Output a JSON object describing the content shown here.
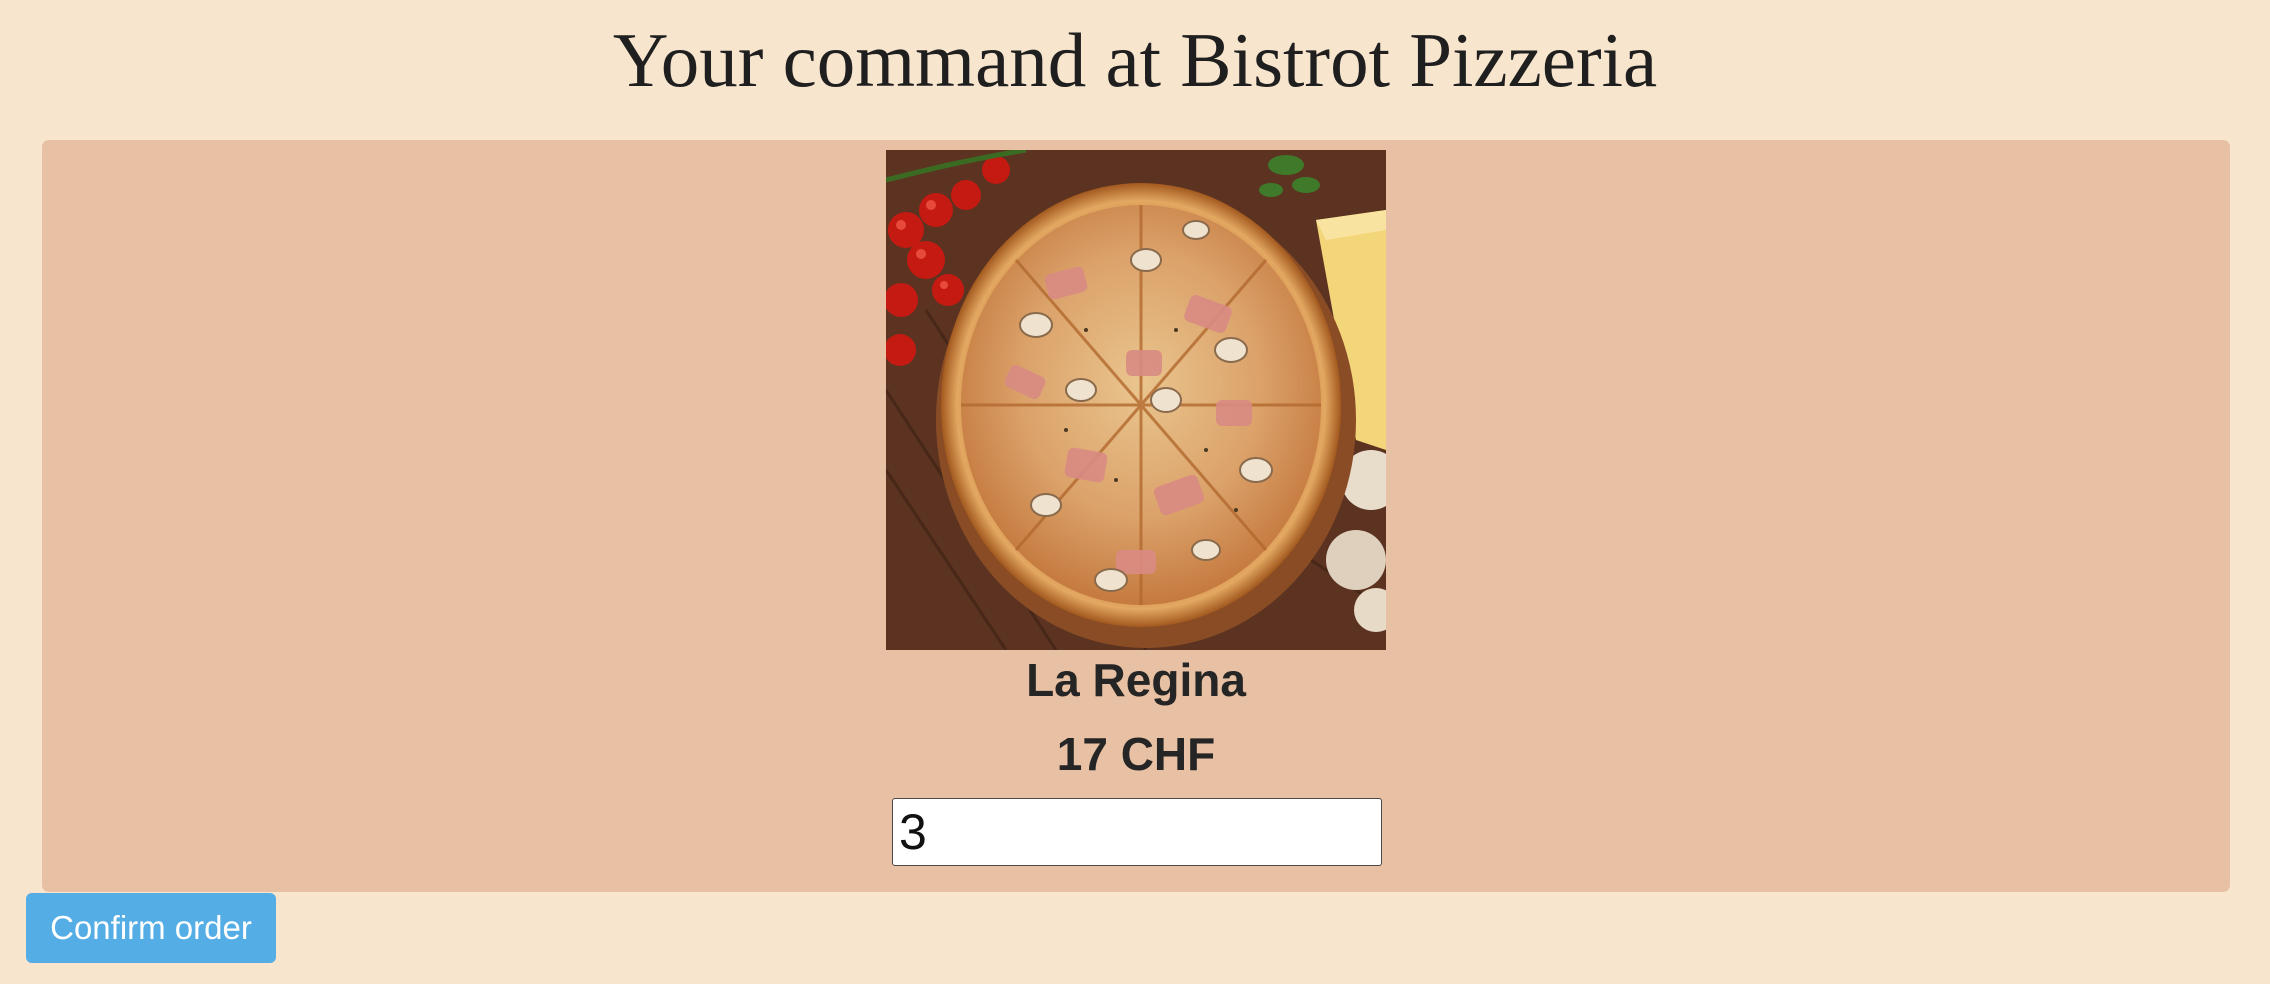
{
  "page": {
    "title": "Your command at Bistrot Pizzeria"
  },
  "order": {
    "items": [
      {
        "image_icon": "pizza-photo",
        "name": "La Regina",
        "price": "17 CHF",
        "quantity": "3"
      }
    ]
  },
  "actions": {
    "confirm_label": "Confirm order"
  },
  "colors": {
    "background": "#f7e5cd",
    "card": "#e8c0a3",
    "button": "#55ade6"
  }
}
